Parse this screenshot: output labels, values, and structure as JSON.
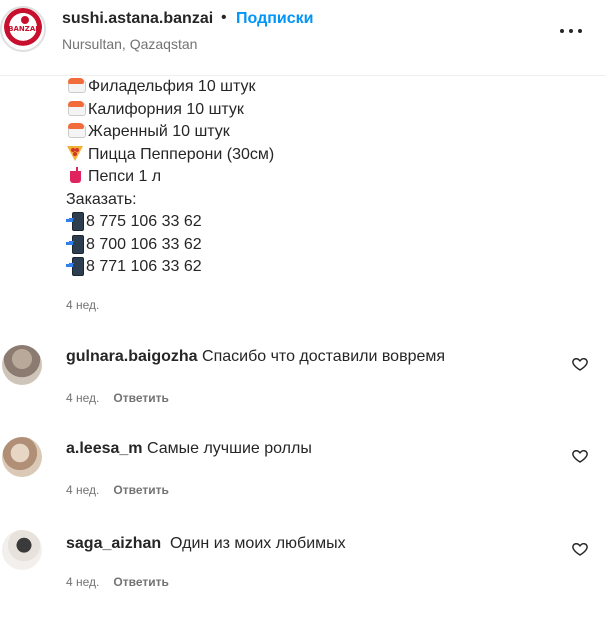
{
  "post": {
    "username": "sushi.astana.banzai",
    "separator": "•",
    "follow_label": "Подписки",
    "location": "Nursultan, Qazaqstan",
    "avatar_logo_text": "BANZAI",
    "more_icon": "more-horizontal-icon",
    "caption_lines": [
      {
        "icon": "sushi-icon",
        "text": "Филадельфия 10 штук"
      },
      {
        "icon": "sushi-icon",
        "text": "Калифорния 10 штук"
      },
      {
        "icon": "sushi-icon",
        "text": "Жаренный 10 штук"
      },
      {
        "icon": "pizza-icon",
        "text": "Пицца Пепперони (30см)"
      },
      {
        "icon": "cup-icon",
        "text": "Пепси 1 л"
      },
      {
        "icon": "",
        "text": "Заказать:"
      },
      {
        "icon": "phone-icon",
        "text": "8 775 106 33 62"
      },
      {
        "icon": "phone-icon",
        "text": "8 700 106 33 62"
      },
      {
        "icon": "phone-icon",
        "text": "8 771 106 33 62"
      }
    ],
    "time": "4 нед."
  },
  "comments": [
    {
      "username": "gulnara.baigozha",
      "text": "Спасибо что доставили вовремя",
      "time": "4 нед.",
      "reply_label": "Ответить"
    },
    {
      "username": "a.leesa_m",
      "text": "Самые лучшие роллы",
      "time": "4 нед.",
      "reply_label": "Ответить"
    },
    {
      "username": "saga_aizhan",
      "text": "Один из моих любимых",
      "time": "4 нед.",
      "reply_label": "Ответить"
    }
  ],
  "colors": {
    "link_blue": "#0095f6",
    "text": "#262626",
    "secondary": "#737373",
    "brand_red": "#c8102e"
  }
}
